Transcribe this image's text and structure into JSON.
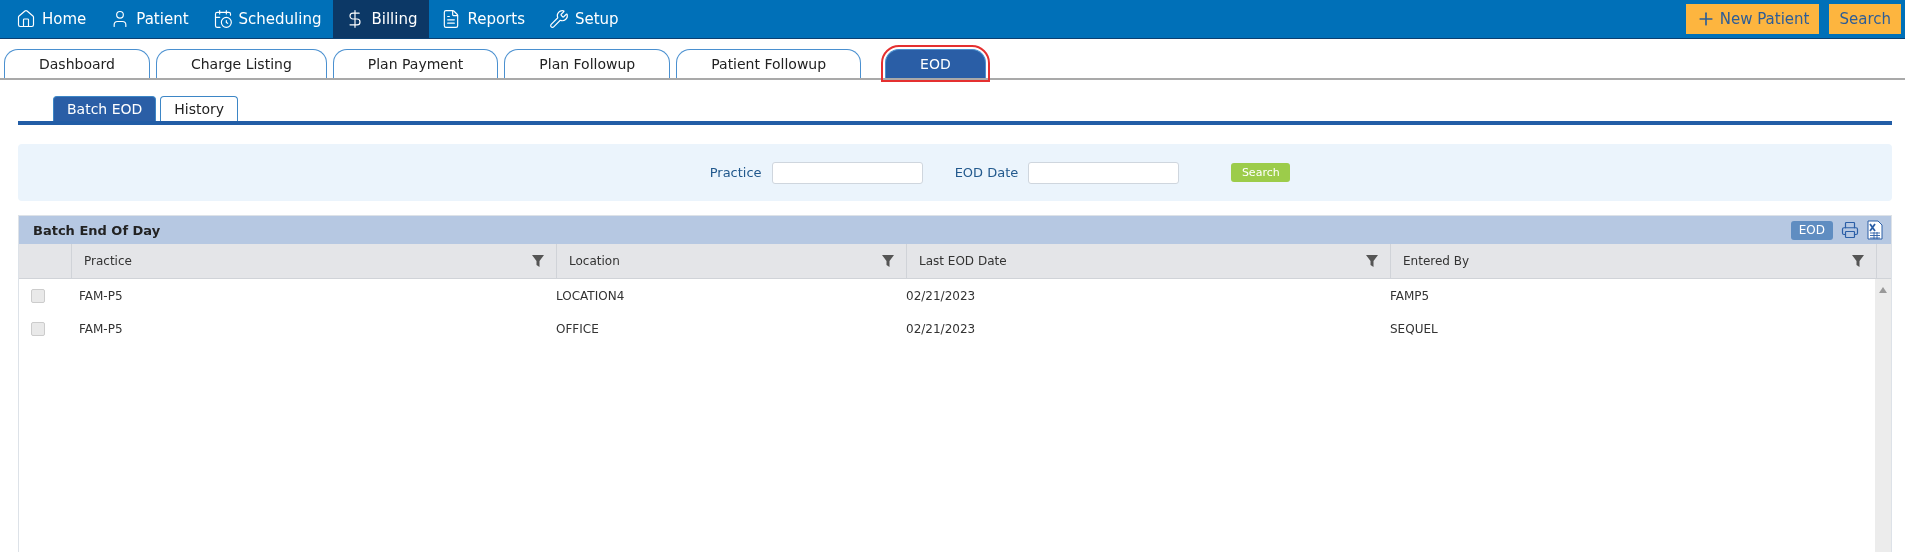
{
  "nav": {
    "items": [
      {
        "label": "Home",
        "selected": false
      },
      {
        "label": "Patient",
        "selected": false
      },
      {
        "label": "Scheduling",
        "selected": false
      },
      {
        "label": "Billing",
        "selected": true
      },
      {
        "label": "Reports",
        "selected": false
      },
      {
        "label": "Setup",
        "selected": false
      }
    ],
    "actions": [
      {
        "label": "New Patient",
        "kind": "add"
      },
      {
        "label": "Search",
        "kind": "plain"
      }
    ]
  },
  "tabs": [
    {
      "label": "Dashboard",
      "selected": false
    },
    {
      "label": "Charge Listing",
      "selected": false
    },
    {
      "label": "Plan Payment",
      "selected": false
    },
    {
      "label": "Plan Followup",
      "selected": false
    },
    {
      "label": "Patient Followup",
      "selected": false
    },
    {
      "label": "EOD",
      "selected": true
    }
  ],
  "subtabs": [
    {
      "label": "Batch EOD",
      "selected": true
    },
    {
      "label": "History",
      "selected": false
    }
  ],
  "filters": {
    "fields": [
      {
        "label": "Practice"
      },
      {
        "label": "EOD Date"
      }
    ],
    "button": "Search"
  },
  "grid": {
    "title": "Batch End Of Day",
    "eod_button": "EOD",
    "columns": [
      "Practice",
      "Location",
      "Last EOD Date",
      "Entered By"
    ],
    "rows": [
      {
        "checked": false,
        "cells": [
          "FAM-P5",
          "LOCATION4",
          "02/21/2023",
          "FAMP5"
        ]
      },
      {
        "checked": false,
        "cells": [
          "FAM-P5",
          "OFFICE",
          "02/21/2023",
          "SEQUEL"
        ]
      }
    ]
  }
}
